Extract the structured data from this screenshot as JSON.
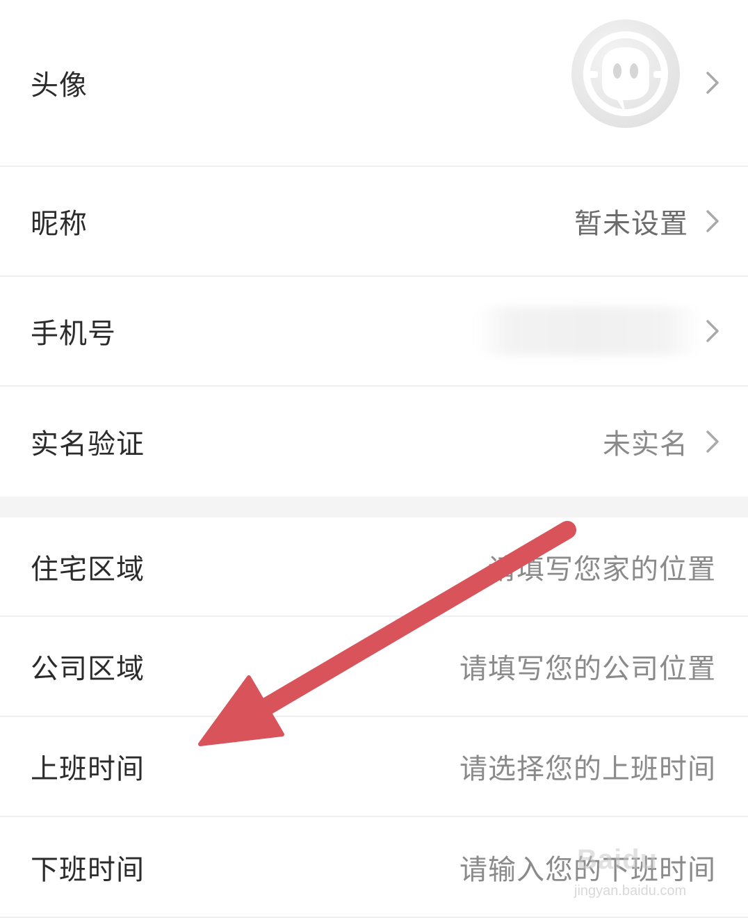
{
  "profile": {
    "avatar": {
      "label": "头像"
    },
    "nickname": {
      "label": "昵称",
      "value": "暂未设置"
    },
    "phone": {
      "label": "手机号"
    },
    "realname": {
      "label": "实名验证",
      "value": "未实名"
    }
  },
  "commute": {
    "home": {
      "label": "住宅区域",
      "placeholder": "请填写您家的位置"
    },
    "company": {
      "label": "公司区域",
      "placeholder": "请填写您的公司位置"
    },
    "work_start": {
      "label": "上班时间",
      "placeholder": "请选择您的上班时间"
    },
    "work_end": {
      "label": "下班时间",
      "placeholder": "请输入您的下班时间"
    }
  },
  "watermark": {
    "brand": "Baidu",
    "url": "jingyan.baidu.com"
  },
  "colors": {
    "annotation_arrow": "#d9535a",
    "label_text": "#2b2b2b",
    "value_text": "#8a8a8a",
    "divider": "#efefef",
    "section_gap": "#f4f4f4"
  },
  "icons": {
    "avatar": "default-avatar-icon",
    "chevron": "chevron-right-icon",
    "annotation": "red-arrow-annotation"
  }
}
